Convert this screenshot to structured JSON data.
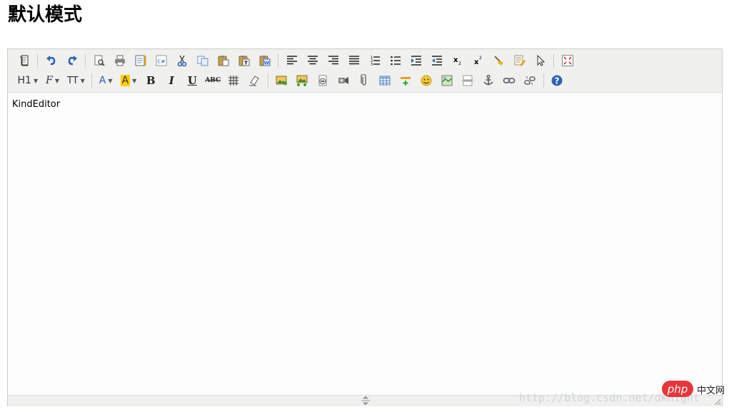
{
  "page": {
    "title": "默认模式"
  },
  "toolbar": {
    "row1": [
      "source-icon",
      "undo-icon",
      "redo-icon",
      "preview-icon",
      "print-icon",
      "template-icon",
      "code-icon",
      "cut-icon",
      "copy-icon",
      "paste-icon",
      "plainpaste-icon",
      "wordpaste-icon",
      "justifyleft-icon",
      "justifycenter-icon",
      "justifyright-icon",
      "justifyfull-icon",
      "ordered-list-icon",
      "unordered-list-icon",
      "indent-icon",
      "outdent-icon",
      "subscript-icon",
      "superscript-icon",
      "clearhtml-icon",
      "quickformat-icon",
      "selectall-icon",
      "fullscreen-icon"
    ],
    "row2": [
      "formatblock-dropdown",
      "fontname-dropdown",
      "fontsize-dropdown",
      "forecolor-dropdown",
      "hilitecolor-dropdown",
      "bold-icon",
      "italic-icon",
      "underline-icon",
      "strikethrough-icon",
      "lineheight-icon",
      "removeformat-icon",
      "image-icon",
      "multiimage-icon",
      "flash-icon",
      "media-icon",
      "insertfile-icon",
      "table-icon",
      "hr-icon",
      "emoticons-icon",
      "baidumap-icon",
      "pagebreak-icon",
      "anchor-icon",
      "link-icon",
      "unlink-icon",
      "about-icon"
    ],
    "formatblock_label": "H1",
    "fontname_label": "F",
    "fontsize_label": "TT",
    "forecolor_label": "A",
    "hilitecolor_label": "A",
    "bold_label": "B",
    "italic_label": "I",
    "underline_label": "U",
    "strike_label": "ABC",
    "subscript_label": "x₂",
    "superscript_label": "x²"
  },
  "editor": {
    "content": "KindEditor"
  },
  "overlay": {
    "watermark": "http://blog.csdn.net/dknight",
    "php_logo": "php",
    "php_cn": "中文网"
  },
  "colors": {
    "accent_blue": "#2a63b8",
    "hilite_yellow": "#ffcc00",
    "php_red": "#e8353a"
  }
}
